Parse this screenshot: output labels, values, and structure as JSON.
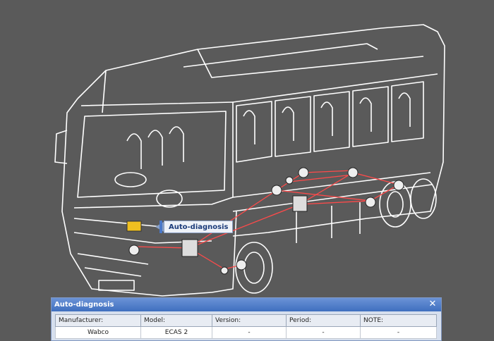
{
  "callout": {
    "label": "Auto-diagnosis"
  },
  "panel": {
    "title": "Auto-diagnosis",
    "close_glyph": "✕",
    "columns": [
      "Manufacturer:",
      "Model:",
      "Version:",
      "Period:",
      "NOTE:"
    ],
    "rows": [
      [
        "Wabco",
        "ECAS 2",
        "-",
        "-",
        "-"
      ]
    ]
  },
  "colors": {
    "background": "#5a5a5a",
    "outline": "#ffffff",
    "wiring": "#ff4a4a",
    "ecu_highlight": "#f0c020",
    "title_bar": "#3f6fbf"
  }
}
